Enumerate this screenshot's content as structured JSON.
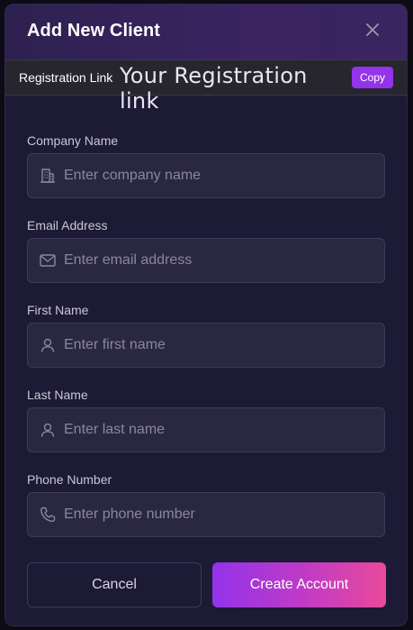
{
  "modal": {
    "title": "Add New Client",
    "close_icon": "close-icon"
  },
  "registration": {
    "label": "Registration Link",
    "value": "Your Registration link",
    "copy_label": "Copy"
  },
  "fields": [
    {
      "label": "Company Name",
      "placeholder": "Enter company name",
      "icon": "building-icon"
    },
    {
      "label": "Email Address",
      "placeholder": "Enter email address",
      "icon": "mail-icon"
    },
    {
      "label": "First Name",
      "placeholder": "Enter first name",
      "icon": "user-icon"
    },
    {
      "label": "Last Name",
      "placeholder": "Enter last name",
      "icon": "user-icon"
    },
    {
      "label": "Phone Number",
      "placeholder": "Enter phone number",
      "icon": "phone-icon"
    }
  ],
  "actions": {
    "cancel_label": "Cancel",
    "create_label": "Create Account"
  },
  "colors": {
    "accent": "#9333ea",
    "accent_end": "#e94a9b",
    "modal_bg": "#1d1a35",
    "input_bg": "#2a2840"
  }
}
